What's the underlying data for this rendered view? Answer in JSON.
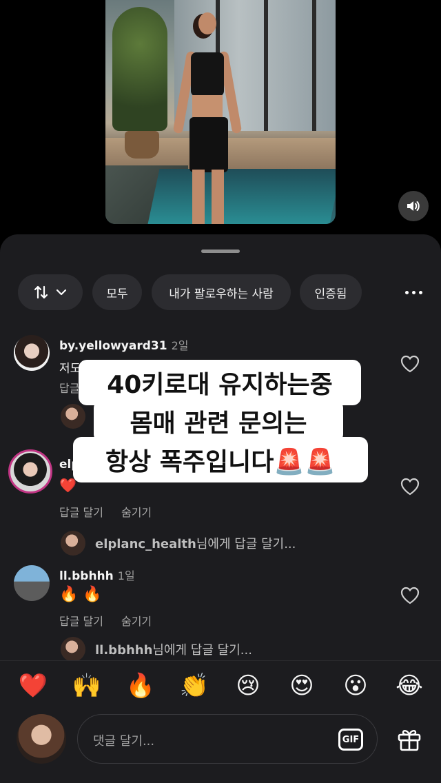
{
  "filters": {
    "sort_label": "",
    "chips": [
      "모두",
      "내가 팔로우하는 사람",
      "인증됨"
    ]
  },
  "comments": [
    {
      "username": "by.yellowyard31",
      "age": "2일",
      "text": "저도..",
      "reply": "답글",
      "hide": ""
    },
    {
      "username": "elplanc_health",
      "age": "",
      "text": "❤️",
      "reply": "답글 달기",
      "hide": "숨기기",
      "reply_prompt_user": "elplanc_health",
      "reply_prompt_suffix": "님에게 답글 달기..."
    },
    {
      "username": "ll.bbhhh",
      "age": "1일",
      "text": "🔥 🔥",
      "reply": "답글 달기",
      "hide": "숨기기",
      "reply_prompt_user": "ll.bbhhh",
      "reply_prompt_suffix": "님에게 답글 달기..."
    }
  ],
  "caption": {
    "line1": "40키로대 유지하는중",
    "line2": "몸매 관련 문의는",
    "line3": "항상 폭주입니다🚨🚨"
  },
  "emojis": [
    "❤️",
    "🙌",
    "🔥",
    "👏",
    "😢",
    "😍",
    "😮",
    "😂"
  ],
  "input": {
    "placeholder": "댓글 달기...",
    "gif_label": "GIF"
  }
}
